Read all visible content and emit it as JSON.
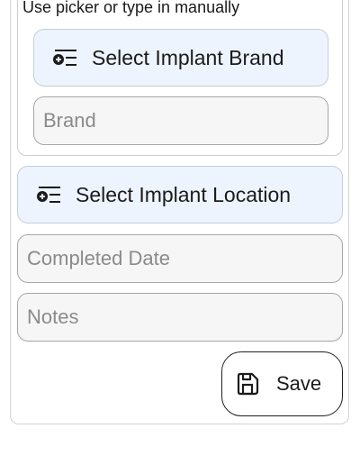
{
  "form": {
    "hint": "Use picker or type in manually",
    "brand_picker_label": "Select Implant Brand",
    "brand_placeholder": "Brand",
    "location_picker_label": "Select Implant Location",
    "completed_date_placeholder": "Completed Date",
    "notes_placeholder": "Notes",
    "save_label": "Save"
  },
  "icons": {
    "picker": "list-add-icon",
    "save": "floppy-disk-icon"
  }
}
